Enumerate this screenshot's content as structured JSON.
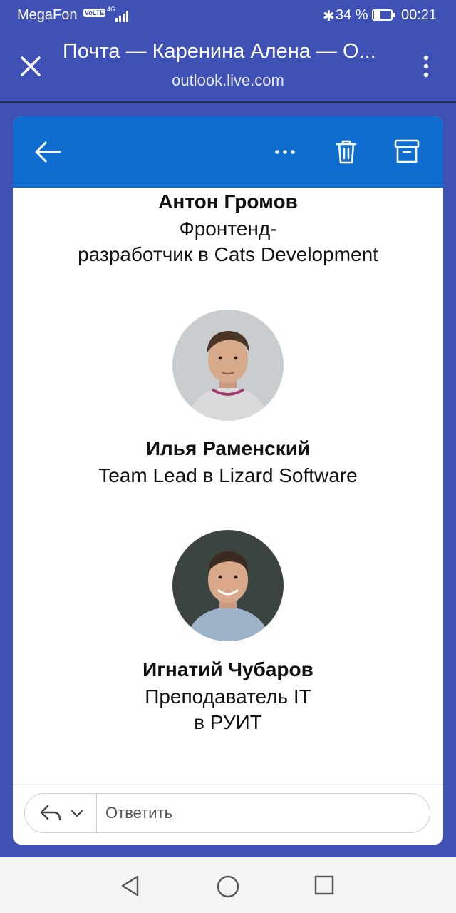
{
  "status": {
    "carrier": "MegaFon",
    "volte": "VoLTE",
    "network": "4G",
    "bluetooth": "✱",
    "battery": "34 %",
    "time": "00:21"
  },
  "browser": {
    "title": "Почта — Каренина Алена — О...",
    "url": "outlook.live.com"
  },
  "toolbar": {
    "back_icon": "arrow-left-icon",
    "more_icon": "more-horizontal-icon",
    "delete_icon": "trash-icon",
    "archive_icon": "archive-icon",
    "accent": "#0f6dd0"
  },
  "people": [
    {
      "name": "Антон Громов",
      "role_line1": "Фронтенд-",
      "role_line2": "разработчик в Cats Development"
    },
    {
      "name": "Илья Раменский",
      "role_line1": "Team Lead в Lizard Software"
    },
    {
      "name": "Игнатий Чубаров",
      "role_line1": "Преподаватель IT",
      "role_line2": "в РУИТ"
    }
  ],
  "reply": {
    "placeholder": "Ответить"
  },
  "colors": {
    "app_bar": "#3f51b5",
    "outlook_blue": "#0f6dd0"
  }
}
